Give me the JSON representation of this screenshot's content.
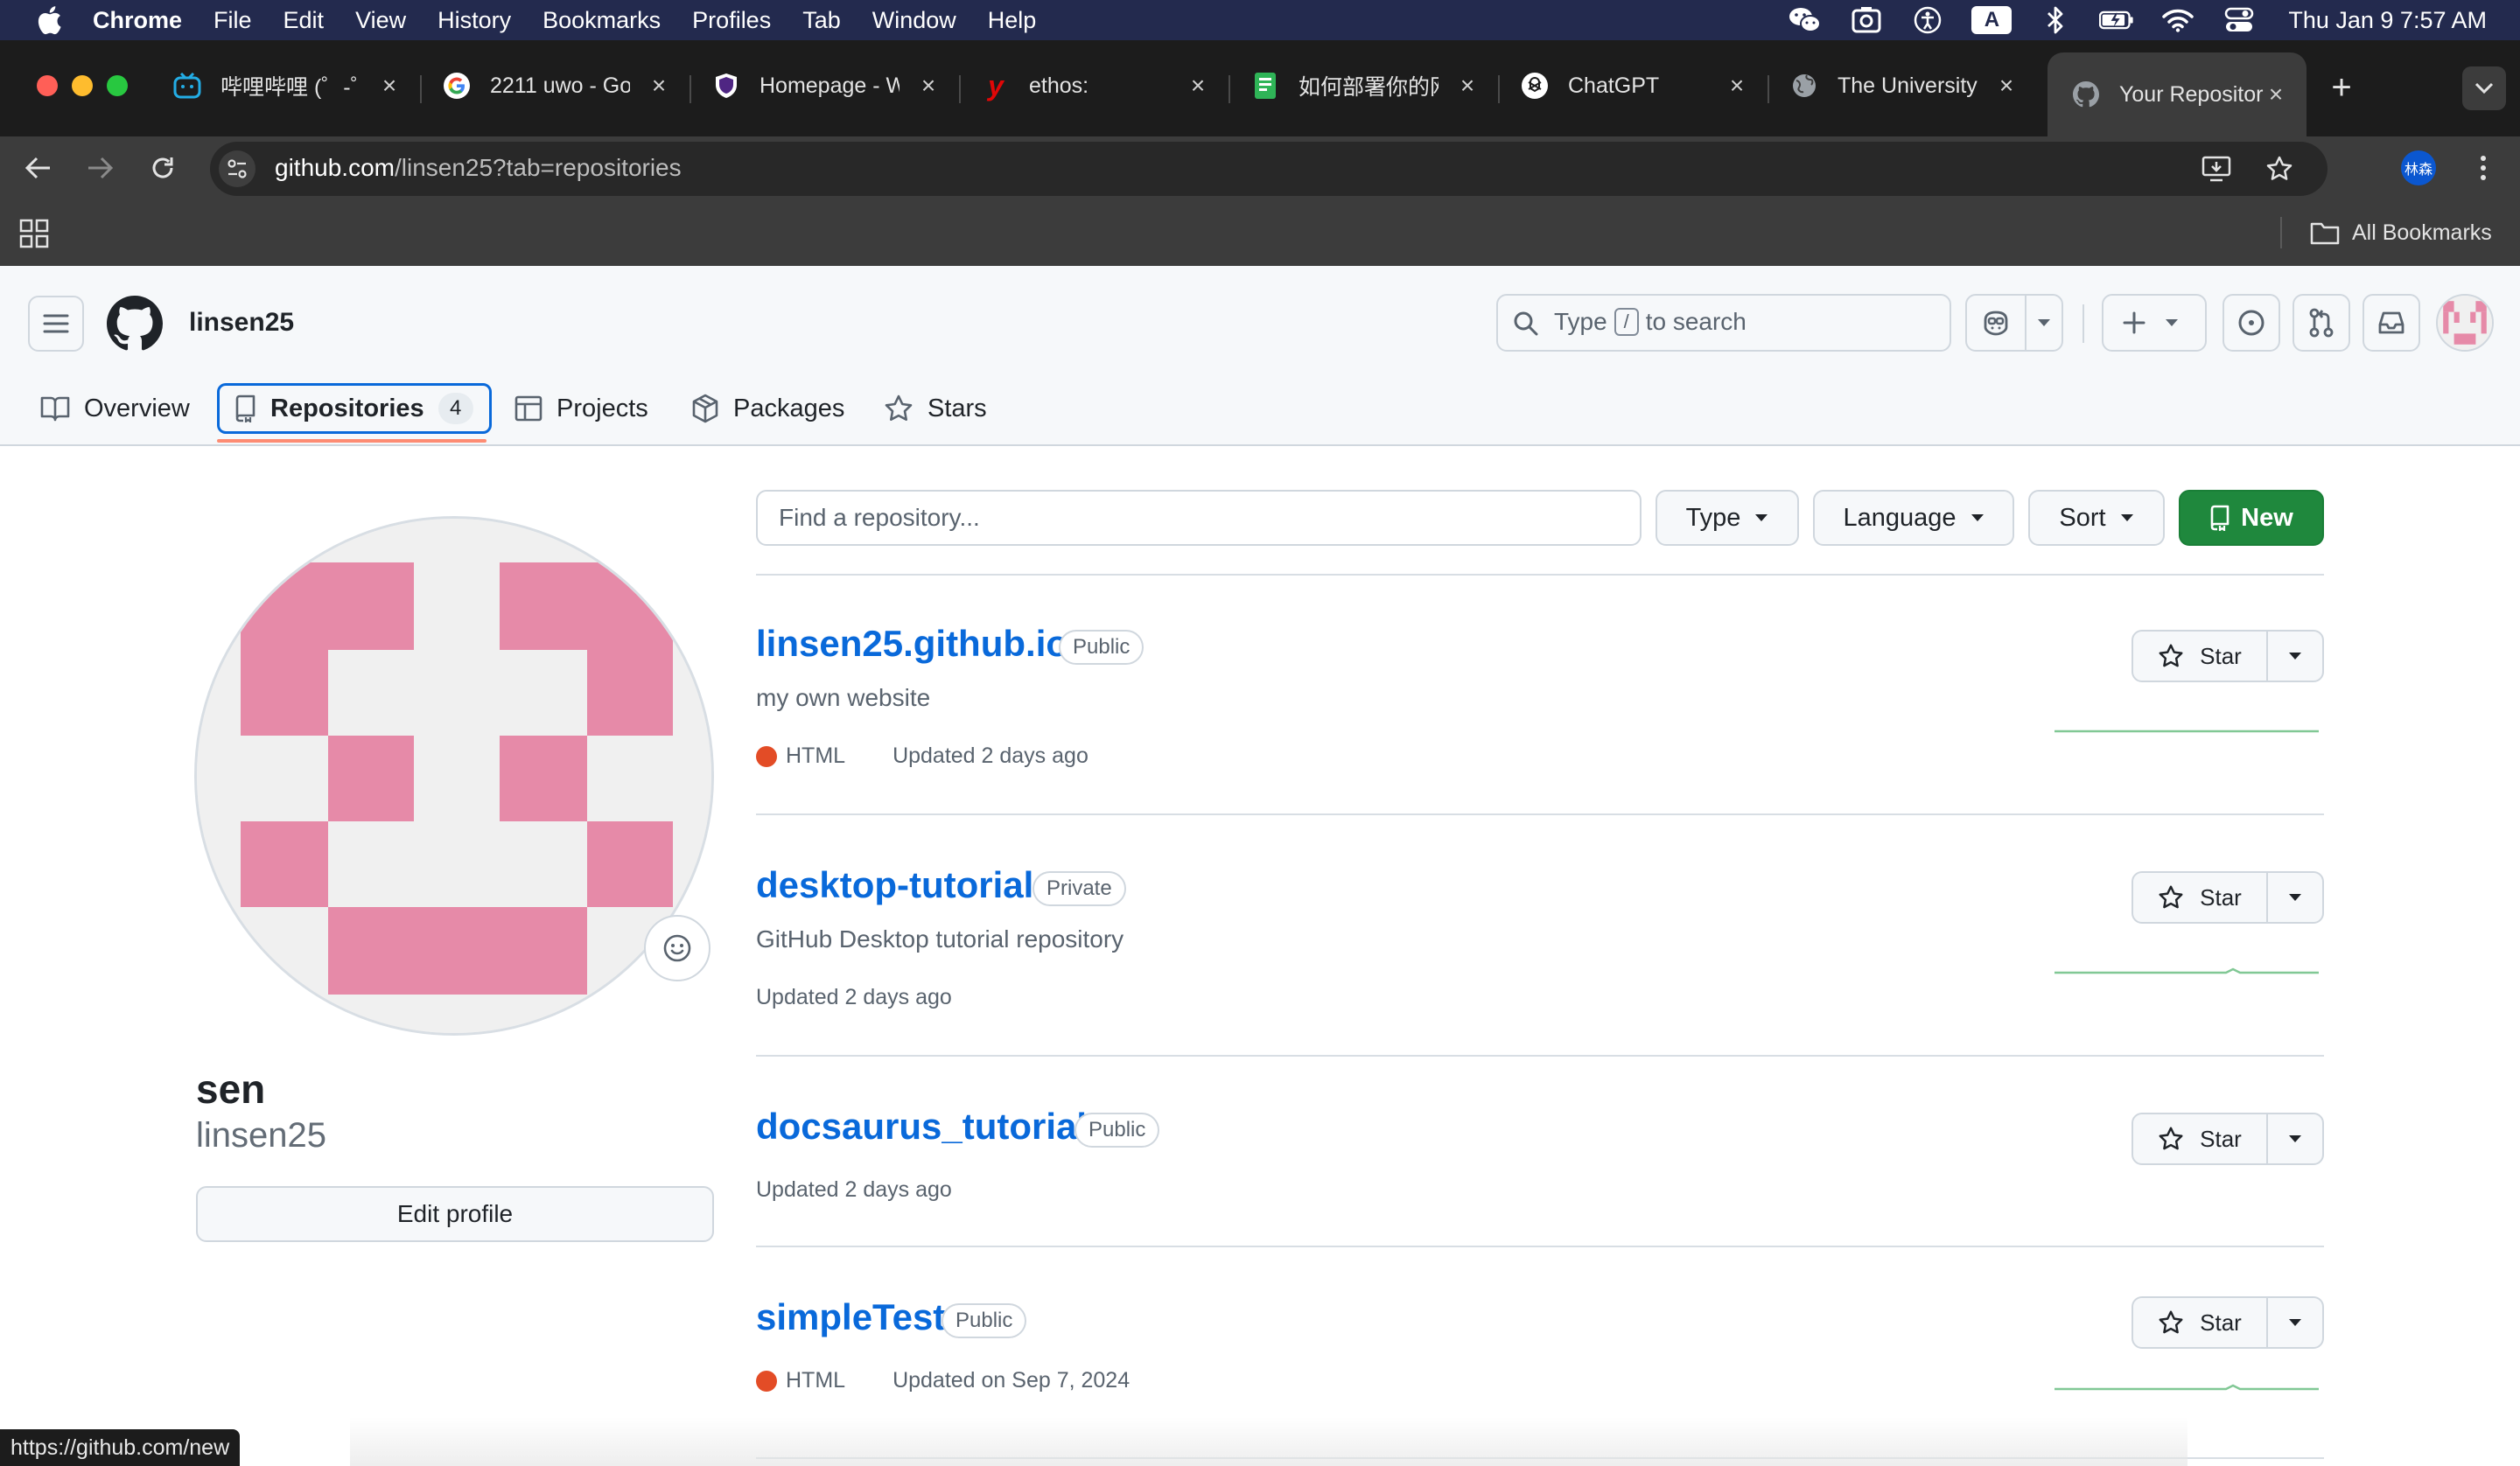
{
  "menubar": {
    "app_name": "Chrome",
    "items": [
      "File",
      "Edit",
      "View",
      "History",
      "Bookmarks",
      "Profiles",
      "Tab",
      "Window",
      "Help"
    ],
    "keyboard_indicator": "A",
    "clock": "Thu Jan 9  7:57 AM",
    "status_icons": [
      "wechat-icon",
      "screenshot-icon",
      "accessibility-icon",
      "input-source-icon",
      "bluetooth-icon",
      "battery-icon",
      "wifi-icon",
      "control-center-icon"
    ]
  },
  "tabs": [
    {
      "title": "哔哩哔哩 (゜-゜",
      "icon": "bilibili-icon",
      "color": "#23ade5"
    },
    {
      "title": "2211 uwo - Go",
      "icon": "google-icon",
      "color": "#4285f4"
    },
    {
      "title": "Homepage - W",
      "icon": "shield-icon",
      "color": "#4f2683"
    },
    {
      "title": "ethos:",
      "icon": "yelp-like-icon",
      "color": "#e00707"
    },
    {
      "title": "如何部署你的网",
      "icon": "doc-icon",
      "color": "#2fb457"
    },
    {
      "title": "ChatGPT",
      "icon": "chatgpt-icon",
      "color": "#ffffff"
    },
    {
      "title": "The University",
      "icon": "globe-icon",
      "color": "#9aa0a6"
    },
    {
      "title": "Your Repositor",
      "icon": "github-icon",
      "color": "#9aa0a6"
    }
  ],
  "toolbar": {
    "url_host": "github.com",
    "url_path": "/linsen25?tab=repositories",
    "profile_initials": "林森"
  },
  "bookmarks": {
    "all_label": "All Bookmarks"
  },
  "github": {
    "username": "linsen25",
    "search_placeholder_before": "Type",
    "search_slash": "/",
    "search_placeholder_after": "to search",
    "profile_tabs": [
      {
        "label": "Overview",
        "icon": "book-icon"
      },
      {
        "label": "Repositories",
        "icon": "repo-icon",
        "count": "4"
      },
      {
        "label": "Projects",
        "icon": "table-icon"
      },
      {
        "label": "Packages",
        "icon": "package-icon"
      },
      {
        "label": "Stars",
        "icon": "star-icon"
      }
    ]
  },
  "profile": {
    "name": "sen",
    "login": "linsen25",
    "edit_label": "Edit profile",
    "avatar_color": "#e68aa8"
  },
  "repo_list": {
    "find_placeholder": "Find a repository...",
    "type_label": "Type",
    "language_label": "Language",
    "sort_label": "Sort",
    "new_label": "New",
    "star_label": "Star",
    "repos": [
      {
        "name": "linsen25.github.io",
        "visibility": "Public",
        "description": "my own website",
        "language": "HTML",
        "updated": "Updated 2 days ago"
      },
      {
        "name": "desktop-tutorial",
        "visibility": "Private",
        "description": "GitHub Desktop tutorial repository",
        "language": "",
        "updated": "Updated 2 days ago"
      },
      {
        "name": "docsaurus_tutorial",
        "visibility": "Public",
        "description": "",
        "language": "",
        "updated": "Updated 2 days ago"
      },
      {
        "name": "simpleTest",
        "visibility": "Public",
        "description": "",
        "language": "HTML",
        "updated": "Updated on Sep 7, 2024"
      }
    ]
  },
  "status_bar": {
    "hover_url": "https://github.com/new"
  },
  "colors": {
    "accent_link": "#0969da",
    "new_button": "#1f883d",
    "html_language": "#e34c26",
    "tab_underline": "#fd8c73",
    "sparkline": "#2da44e"
  }
}
